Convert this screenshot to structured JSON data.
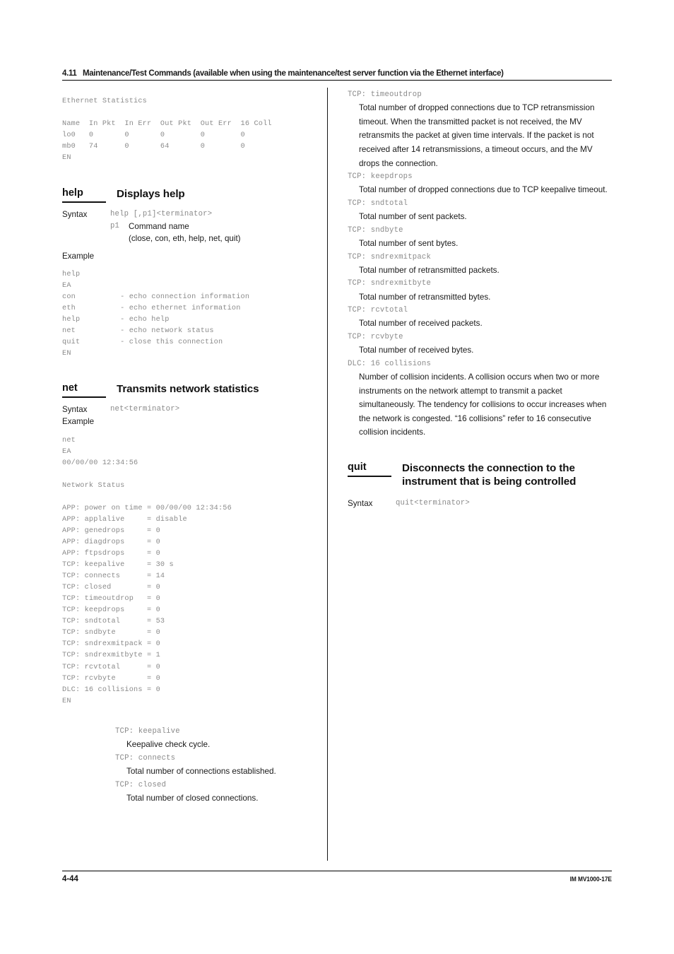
{
  "header": {
    "number": "4.11",
    "title": "Maintenance/Test Commands (available when using the maintenance/test server function via the Ethernet interface)"
  },
  "footer": {
    "page": "4-44",
    "doc_id": "IM MV1000-17E"
  },
  "left_column": {
    "ethernet_output": "Ethernet Statistics\n\nName  In Pkt  In Err  Out Pkt  Out Err  16 Coll\nlo0   0       0       0        0        0\nmb0   74      0       64       0        0\nEN",
    "help_section": {
      "command": "help",
      "title": "Displays help",
      "syntax_label": "Syntax",
      "syntax_value": "help [,p1]<terminator>",
      "param_key": "p1",
      "param_text": "Command name",
      "param_options": "(close, con, eth, help, net, quit)",
      "example_label": "Example",
      "example_output": "help\nEA\ncon          - echo connection information\neth          - echo ethernet information\nhelp         - echo help\nnet          - echo network status\nquit         - close this connection\nEN"
    },
    "net_section": {
      "command": "net",
      "title": "Transmits network statistics",
      "syntax_label": "Syntax",
      "syntax_value": "net<terminator>",
      "example_label": "Example",
      "example_output": "net\nEA\n00/00/00 12:34:56\n\nNetwork Status\n\nAPP: power on time = 00/00/00 12:34:56\nAPP: applalive     = disable\nAPP: genedrops     = 0\nAPP: diagdrops     = 0\nAPP: ftpsdrops     = 0\nTCP: keepalive     = 30 s\nTCP: connects      = 14\nTCP: closed        = 0\nTCP: timeoutdrop   = 0\nTCP: keepdrops     = 0\nTCP: sndtotal      = 53\nTCP: sndbyte       = 0\nTCP: sndrexmitpack = 0\nTCP: sndrexmitbyte = 1\nTCP: rcvtotal      = 0\nTCP: rcvbyte       = 0\nDLC: 16 collisions = 0\nEN"
    },
    "definitions": [
      {
        "term": "TCP: keepalive",
        "desc": "Keepalive check cycle."
      },
      {
        "term": "TCP: connects",
        "desc": "Total number of connections established."
      },
      {
        "term": "TCP: closed",
        "desc": "Total number of closed connections."
      }
    ]
  },
  "right_column": {
    "definitions": [
      {
        "term": "TCP: timeoutdrop",
        "desc": "Total number of dropped connections due to TCP retransmission timeout. When the transmitted packet is not received, the MV retransmits the packet at given time intervals. If the packet is not received after 14 retransmissions, a timeout occurs, and the MV drops the connection."
      },
      {
        "term": "TCP: keepdrops",
        "desc": "Total number of dropped connections due to TCP keepalive timeout."
      },
      {
        "term": "TCP: sndtotal",
        "desc": "Total number of sent packets."
      },
      {
        "term": "TCP: sndbyte",
        "desc": "Total number of sent bytes."
      },
      {
        "term": "TCP: sndrexmitpack",
        "desc": "Total number of retransmitted packets."
      },
      {
        "term": "TCP: sndrexmitbyte",
        "desc": "Total number of retransmitted bytes."
      },
      {
        "term": "TCP: rcvtotal",
        "desc": "Total number of received packets."
      },
      {
        "term": "TCP: rcvbyte",
        "desc": "Total number of received bytes."
      },
      {
        "term": "DLC: 16 collisions",
        "desc": "Number of collision incidents. A collision occurs when two or more instruments on the network attempt to transmit a packet simultaneously. The tendency for collisions to occur increases when the network is congested. “16 collisions” refer to 16 consecutive collision incidents."
      }
    ],
    "quit_section": {
      "command": "quit",
      "title": "Disconnects the connection to the instrument that is being controlled",
      "syntax_label": "Syntax",
      "syntax_value": "quit<terminator>"
    }
  }
}
